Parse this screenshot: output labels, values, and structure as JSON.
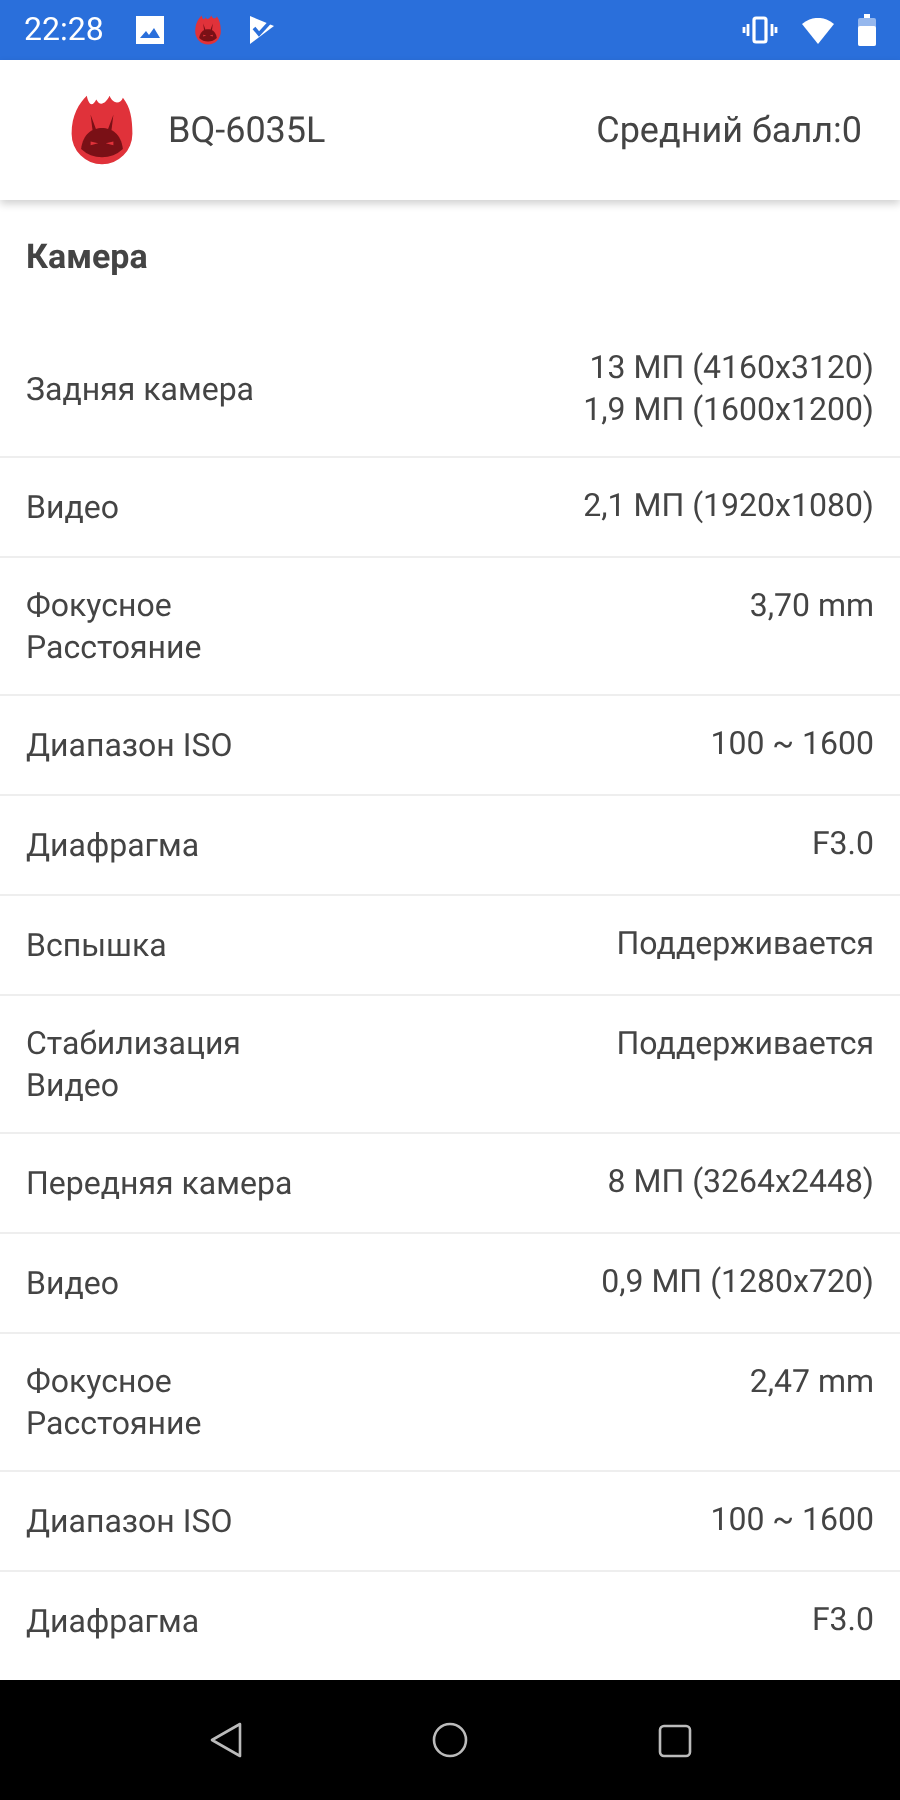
{
  "status_bar": {
    "time": "22:28"
  },
  "header": {
    "device": "BQ-6035L",
    "score": "Средний балл:0"
  },
  "section": {
    "title": "Камера"
  },
  "rows": [
    {
      "label": [
        "Задняя камера"
      ],
      "value": [
        "13 МП (4160x3120)",
        "1,9 МП (1600x1200)"
      ]
    },
    {
      "label": [
        "Видео"
      ],
      "value": [
        "2,1 МП (1920x1080)"
      ]
    },
    {
      "label": [
        "Фокусное",
        "Расстояние"
      ],
      "value": [
        "3,70 mm"
      ]
    },
    {
      "label": [
        "Диапазон ISO"
      ],
      "value": [
        "100 ~ 1600"
      ]
    },
    {
      "label": [
        "Диафрагма"
      ],
      "value": [
        "F3.0"
      ]
    },
    {
      "label": [
        "Вспышка"
      ],
      "value": [
        "Поддерживается"
      ]
    },
    {
      "label": [
        "Стабилизация",
        "Видео"
      ],
      "value": [
        "Поддерживается"
      ]
    },
    {
      "label": [
        "Передняя камера"
      ],
      "value": [
        "8 МП (3264x2448)"
      ]
    },
    {
      "label": [
        "Видео"
      ],
      "value": [
        "0,9 МП (1280x720)"
      ]
    },
    {
      "label": [
        "Фокусное",
        "Расстояние"
      ],
      "value": [
        "2,47 mm"
      ]
    },
    {
      "label": [
        "Диапазон ISO"
      ],
      "value": [
        "100 ~ 1600"
      ]
    },
    {
      "label": [
        "Диафрагма"
      ],
      "value": [
        "F3.0"
      ]
    }
  ]
}
